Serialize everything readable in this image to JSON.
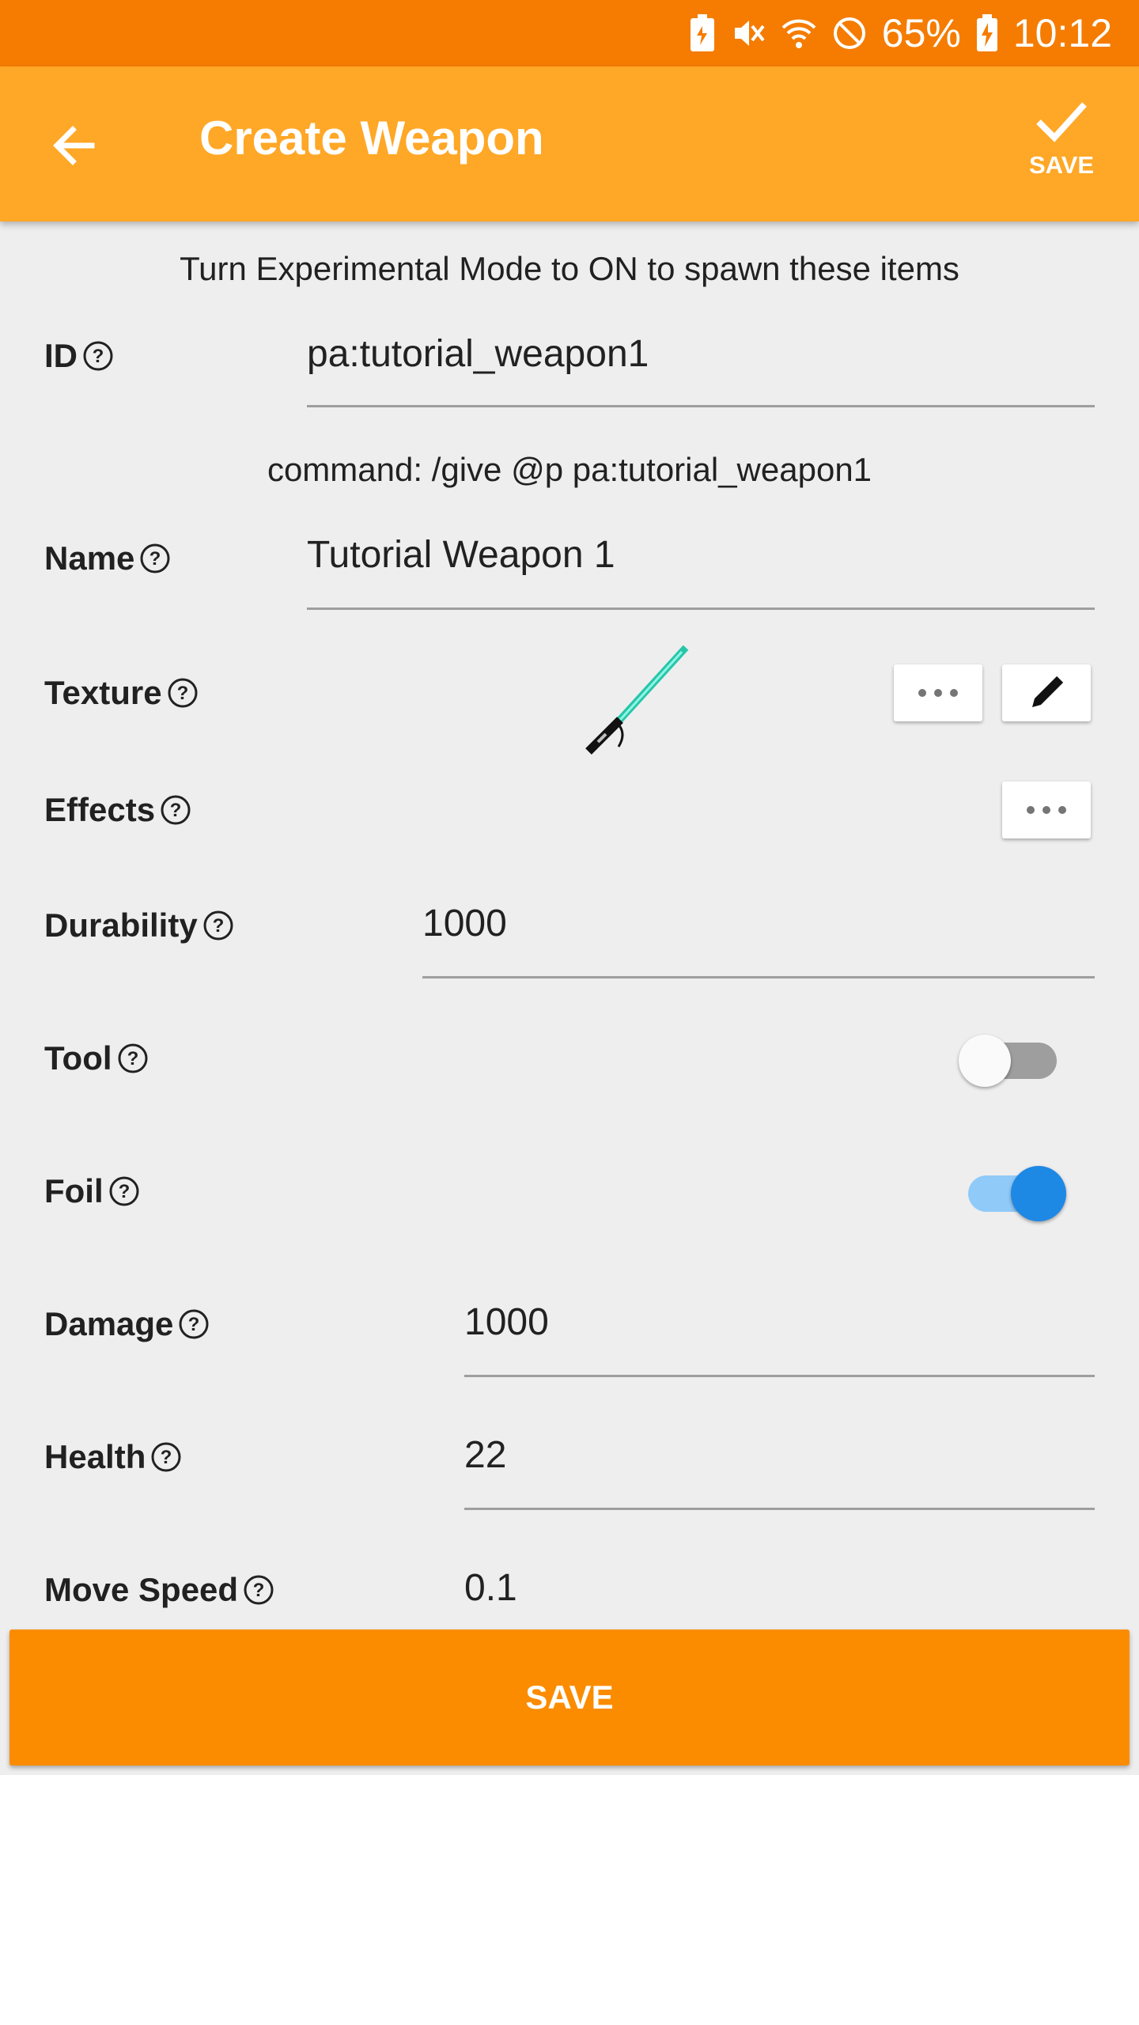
{
  "status_bar": {
    "battery": "65%",
    "time": "10:12",
    "icons": [
      "battery-saver-icon",
      "mute-icon",
      "wifi-icon",
      "do-not-disturb-icon",
      "battery-charging-icon"
    ]
  },
  "app_bar": {
    "title": "Create Weapon",
    "save_label": "SAVE",
    "back_icon": "arrow-back-icon",
    "save_icon": "check-icon"
  },
  "form": {
    "notice": "Turn Experimental Mode to ON to spawn these items",
    "id": {
      "label": "ID",
      "value": "pa:tutorial_weapon1"
    },
    "command": "command: /give @p pa:tutorial_weapon1",
    "name": {
      "label": "Name",
      "value": "Tutorial Weapon 1"
    },
    "texture": {
      "label": "Texture",
      "preview": "lightsaber-texture"
    },
    "effects": {
      "label": "Effects"
    },
    "durability": {
      "label": "Durability",
      "value": "1000"
    },
    "tool": {
      "label": "Tool",
      "enabled": false
    },
    "foil": {
      "label": "Foil",
      "enabled": true
    },
    "damage": {
      "label": "Damage",
      "value": "1000"
    },
    "health": {
      "label": "Health",
      "value": "22"
    },
    "move_speed": {
      "label": "Move Speed",
      "value": "0.1"
    }
  },
  "bottom_button": {
    "label": "SAVE"
  },
  "colors": {
    "status_bar": "#f57c00",
    "app_bar": "#ffa726",
    "save_button": "#fb8c00",
    "toggle_on": "#1e88e5"
  }
}
